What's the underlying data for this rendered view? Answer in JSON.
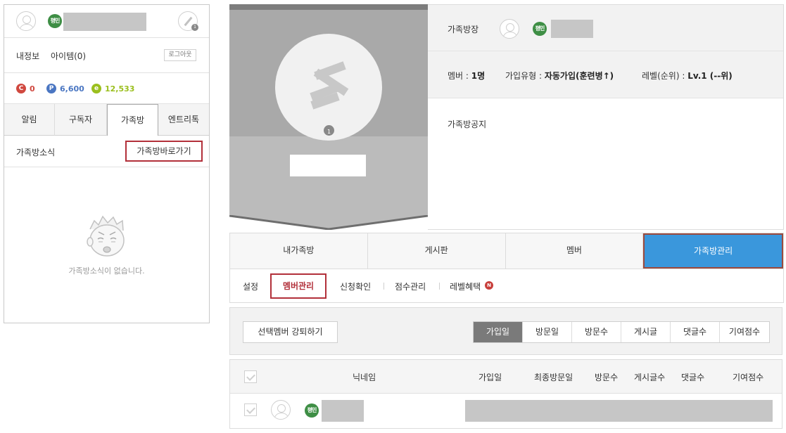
{
  "left_panel": {
    "user_badge": "평민",
    "menu": {
      "my_info": "내정보",
      "items": "아이템(0)",
      "logout": "로그아웃"
    },
    "points": [
      {
        "icon": "C",
        "value": "0",
        "color": "#d0483f"
      },
      {
        "icon": "P",
        "value": "6,600",
        "color": "#4a76c2"
      },
      {
        "icon": "e",
        "value": "12,533",
        "color": "#9bbf1e"
      }
    ],
    "tabs": [
      "알림",
      "구독자",
      "가족방",
      "엔트리톡"
    ],
    "active_tab": "가족방",
    "news_title": "가족방소식",
    "go_button": "가족방바로가기",
    "empty_message": "가족방소식이 없습니다."
  },
  "banner": {
    "level_number": "1"
  },
  "family_info": {
    "owner_label": "가족방장",
    "owner_badge": "평민",
    "member_label": "멤버 : ",
    "member_value": "1명",
    "join_type_label": "가입유형 : ",
    "join_type_value": "자동가입(훈련병↑)",
    "level_label": "레벨(순위) : ",
    "level_value": "Lv.1 (--위)",
    "notice_label": "가족방공지"
  },
  "main_tabs": [
    "내가족방",
    "게시판",
    "멤버",
    "가족방관리"
  ],
  "active_main_tab": "가족방관리",
  "sub_menu": {
    "settings": "설정",
    "member_manage": "멤버관리",
    "apply_check": "신청확인",
    "score_manage": "점수관리",
    "level_benefit": "레벨혜택",
    "new_badge": "N"
  },
  "toolbar": {
    "kick_button": "선택멤버 강퇴하기",
    "sort_options": [
      "가입일",
      "방문일",
      "방문수",
      "게시글",
      "댓글수",
      "기여점수"
    ],
    "active_sort": "가입일"
  },
  "table": {
    "headers": [
      "닉네임",
      "가입일",
      "최종방문일",
      "방문수",
      "게시글수",
      "댓글수",
      "기여점수"
    ],
    "row_badge": "평민"
  }
}
